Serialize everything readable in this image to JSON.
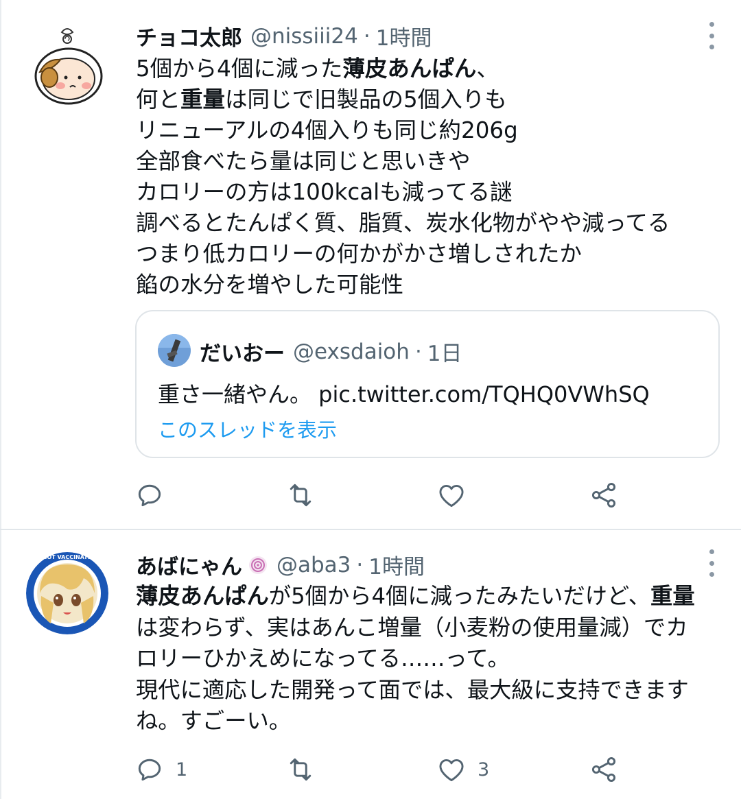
{
  "tweets": [
    {
      "name": "チョコ太郎",
      "handle": "@nissiii24",
      "separator": "·",
      "time": "1時間",
      "lines": [
        [
          {
            "t": "5個から4個に減った"
          },
          {
            "t": "薄皮あんぱん",
            "b": true
          },
          {
            "t": "、"
          }
        ],
        [
          {
            "t": "何と"
          },
          {
            "t": "重量",
            "b": true
          },
          {
            "t": "は同じで旧製品の5個入りも"
          }
        ],
        [
          {
            "t": "リニューアルの4個入りも同じ約206g"
          }
        ],
        [
          {
            "t": "全部食べたら量は同じと思いきや"
          }
        ],
        [
          {
            "t": "カロリーの方は100kcalも減ってる謎"
          }
        ],
        [
          {
            "t": "調べるとたんぱく質、脂質、炭水化物がやや減ってる"
          }
        ],
        [
          {
            "t": "つまり低カロリーの何かがかさ増しされたか"
          }
        ],
        [
          {
            "t": "餡の水分を増やした可能性"
          }
        ]
      ],
      "quote": {
        "name": "だいおー",
        "handle": "@exsdaioh",
        "separator": "·",
        "time": "1日",
        "text": "重さ一緒やん。 pic.twitter.com/TQHQ0VWhSQ",
        "thread_link": "このスレッドを表示"
      },
      "counts": {
        "reply": "",
        "retweet": "",
        "like": ""
      }
    },
    {
      "name": "あばにゃん",
      "handle": "@aba3",
      "separator": "·",
      "time": "1時間",
      "lines": [
        [
          {
            "t": "薄皮あんぱん",
            "b": true
          },
          {
            "t": "が5個から4個に減ったみたいだけど、"
          },
          {
            "t": "重量",
            "b": true
          }
        ],
        [
          {
            "t": "は変わらず、実はあんこ増量（小麦粉の使用量減）でカ"
          }
        ],
        [
          {
            "t": "ロリーひかえめになってる……って。"
          }
        ],
        [
          {
            "t": "現代に適応した開発って面では、最大級に支持できます"
          }
        ],
        [
          {
            "t": "ね。すごーい。"
          }
        ]
      ],
      "counts": {
        "reply": "1",
        "retweet": "",
        "like": "3"
      }
    }
  ],
  "icons": [
    "more-icon",
    "reply-icon",
    "retweet-icon",
    "like-icon",
    "share-icon",
    "badge-icon"
  ],
  "colors": {
    "link": "#1d9bf0",
    "secondary_text": "#536471",
    "icon": "#536471",
    "border": "#dfe4e8"
  }
}
